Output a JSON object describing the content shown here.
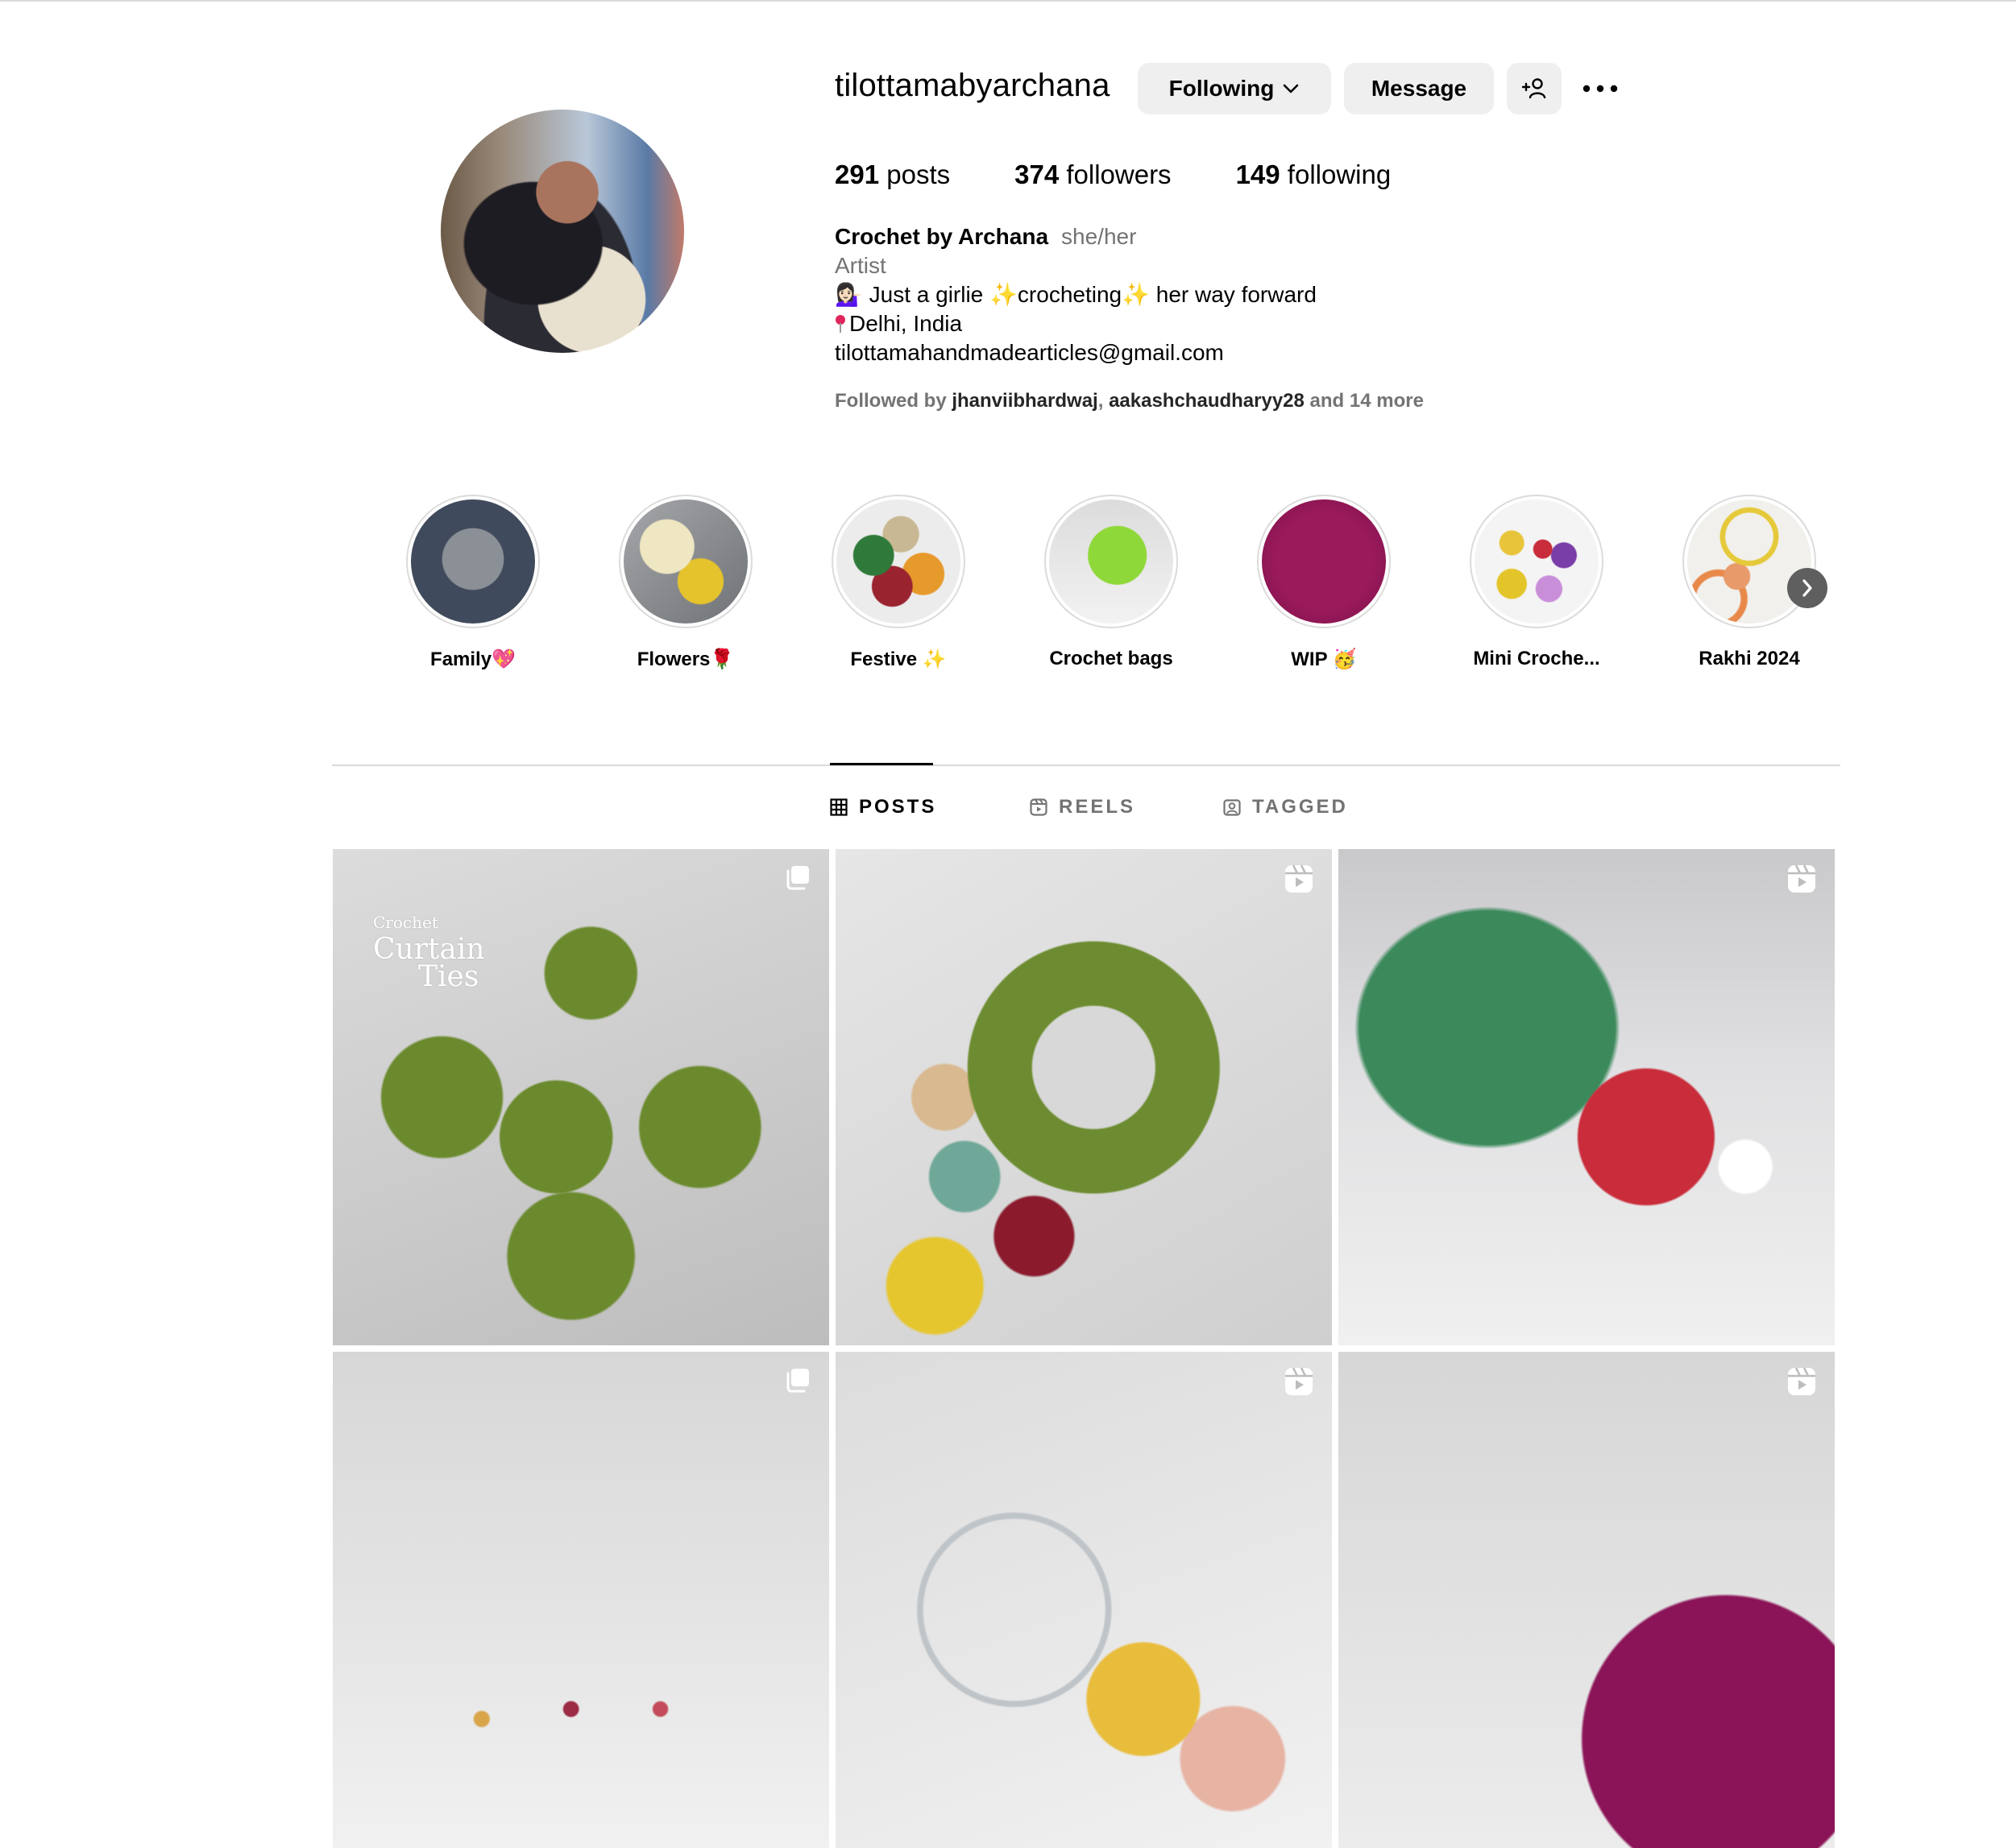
{
  "profile": {
    "username": "tilottamabyarchana",
    "following_label": "Following",
    "message_label": "Message",
    "stats": {
      "posts_count": "291",
      "posts_label": "posts",
      "followers_count": "374",
      "followers_label": "followers",
      "following_count": "149",
      "following_label": "following"
    },
    "bio": {
      "name": "Crochet by Archana",
      "pronouns": "she/her",
      "category": "Artist",
      "line1_prefix": "💁🏻‍♀️ Just a girlie ",
      "line1_mid": "crocheting",
      "line1_suffix": " her way forward",
      "sparkle": "✨",
      "location": "Delhi, India",
      "email": "tilottamahandmadearticles@gmail.com"
    },
    "followed_by": {
      "prefix": "Followed by ",
      "user1": "jhanviibhardwaj",
      "sep": ", ",
      "user2": "aakashchaudharyy28",
      "suffix": " and 14 more"
    }
  },
  "highlights": [
    {
      "label": "Family💖",
      "color": "#4a5a6e"
    },
    {
      "label": "Flowers🌹",
      "color": "#8d8f92"
    },
    {
      "label": "Festive ✨",
      "color": "#c88a4a"
    },
    {
      "label": "Crochet bags",
      "color": "#8cd23a"
    },
    {
      "label": "WIP 🥳",
      "color": "#8a1450"
    },
    {
      "label": "Mini Croche...",
      "color": "#e7c14a"
    },
    {
      "label": "Rakhi 2024",
      "color": "#e8a64a"
    }
  ],
  "tabs": [
    {
      "label": "POSTS",
      "icon": "grid-icon",
      "active": true
    },
    {
      "label": "REELS",
      "icon": "reels-icon",
      "active": false
    },
    {
      "label": "TAGGED",
      "icon": "tagged-icon",
      "active": false
    }
  ],
  "posts": [
    {
      "type": "carousel",
      "overlay_line1": "Crochet",
      "overlay_line2": "Curtain",
      "overlay_line3": "Ties"
    },
    {
      "type": "reel"
    },
    {
      "type": "reel"
    },
    {
      "type": "carousel"
    },
    {
      "type": "reel"
    },
    {
      "type": "reel"
    }
  ]
}
